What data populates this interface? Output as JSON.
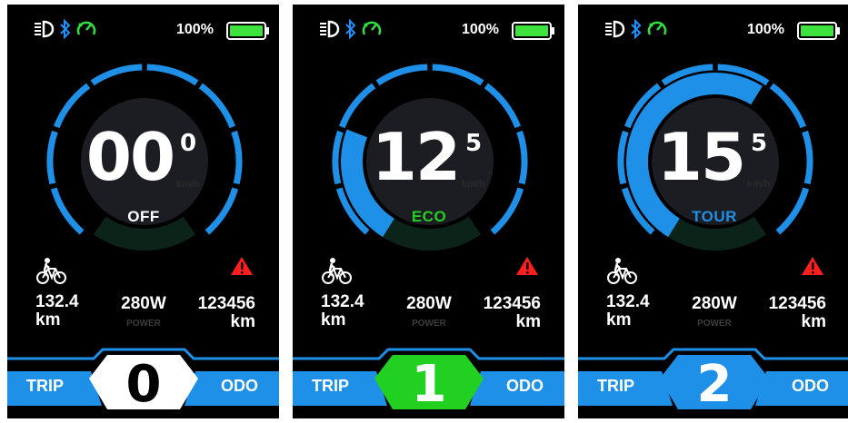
{
  "colors": {
    "accent_blue": "#1e90e8",
    "dark_ring": "#242424",
    "gauge_face": "#1b1d22",
    "eco_green": "#22d022",
    "battery_green": "#3de23d",
    "warning_red": "#ff1e1e",
    "headlight_white": "#ffffff",
    "bluetooth_blue": "#1e90ff",
    "speedo_green": "#2ee040"
  },
  "screens": [
    {
      "icons": [
        "headlight-icon",
        "bluetooth-icon",
        "speedometer-icon"
      ],
      "battery": {
        "percent_label": "100%",
        "level": 1.0
      },
      "speed": {
        "whole": "00",
        "decimal": "0",
        "unit": "km/h"
      },
      "mode": {
        "label": "OFF",
        "color": "#ffffff"
      },
      "assist_arc_fraction": 0,
      "trip": {
        "value": "132.4",
        "unit": "km"
      },
      "power": {
        "value": "280W",
        "label": "POWER"
      },
      "odo": {
        "value": "123456",
        "unit": "km"
      },
      "bottom": {
        "left": "TRIP",
        "right": "ODO",
        "level": "0",
        "badge_color": "#ffffff",
        "level_color": "#000000"
      }
    },
    {
      "icons": [
        "headlight-icon",
        "bluetooth-icon",
        "speedometer-icon"
      ],
      "battery": {
        "percent_label": "100%",
        "level": 1.0
      },
      "speed": {
        "whole": "12",
        "decimal": "5",
        "unit": "km/h"
      },
      "mode": {
        "label": "ECO",
        "color": "#22d022"
      },
      "assist_arc_fraction": 0.22,
      "trip": {
        "value": "132.4",
        "unit": "km"
      },
      "power": {
        "value": "280W",
        "label": "POWER"
      },
      "odo": {
        "value": "123456",
        "unit": "km"
      },
      "bottom": {
        "left": "TRIP",
        "right": "ODO",
        "level": "1",
        "badge_color": "#22d022",
        "level_color": "#ffffff"
      }
    },
    {
      "icons": [
        "headlight-icon",
        "bluetooth-icon",
        "speedometer-icon"
      ],
      "battery": {
        "percent_label": "100%",
        "level": 1.0
      },
      "speed": {
        "whole": "15",
        "decimal": "5",
        "unit": "km/h"
      },
      "mode": {
        "label": "TOUR",
        "color": "#1e90e8"
      },
      "assist_arc_fraction": 0.5,
      "trip": {
        "value": "132.4",
        "unit": "km"
      },
      "power": {
        "value": "280W",
        "label": "POWER"
      },
      "odo": {
        "value": "123456",
        "unit": "km"
      },
      "bottom": {
        "left": "TRIP",
        "right": "ODO",
        "level": "2",
        "badge_color": "#1e90e8",
        "level_color": "#ffffff"
      }
    }
  ]
}
